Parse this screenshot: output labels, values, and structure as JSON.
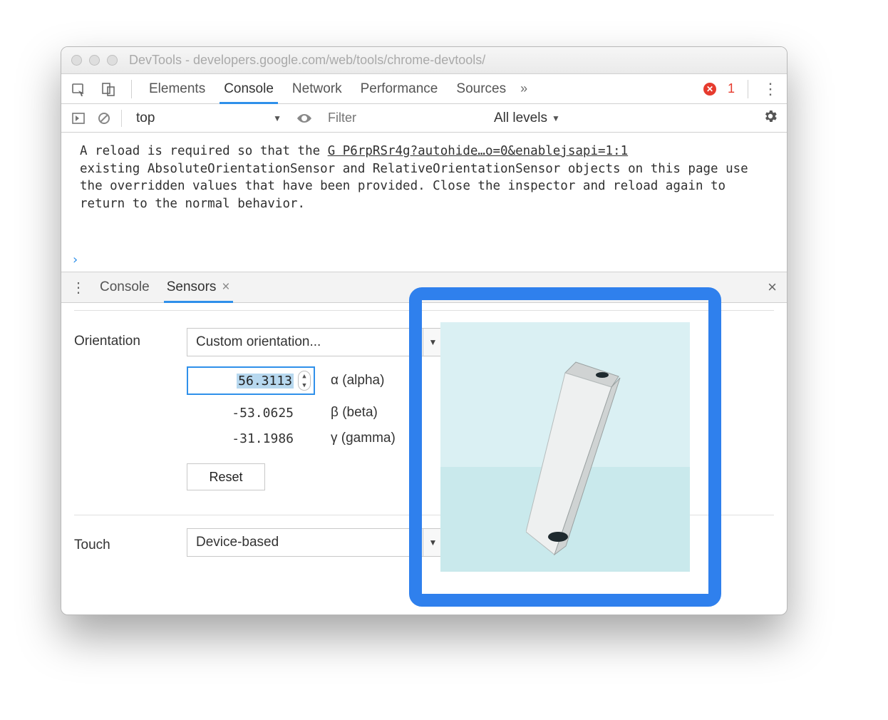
{
  "window": {
    "title": "DevTools - developers.google.com/web/tools/chrome-devtools/"
  },
  "topbar": {
    "tabs": [
      "Elements",
      "Console",
      "Network",
      "Performance",
      "Sources"
    ],
    "active_tab": "Console",
    "error_symbol": "✕",
    "error_count": "1"
  },
  "console_toolbar": {
    "context": "top",
    "filter_placeholder": "Filter",
    "levels_label": "All levels"
  },
  "console": {
    "message_prefix": "A reload is required so that the ",
    "source_link": "G P6rpRSr4g?autohide…o=0&enablejsapi=1:1",
    "message_rest": "existing AbsoluteOrientationSensor and RelativeOrientationSensor objects on this page use the overridden values that have been provided. Close the inspector and reload again to return to the normal behavior.",
    "prompt": "›"
  },
  "drawer": {
    "tabs": [
      "Console",
      "Sensors"
    ],
    "active_tab": "Sensors",
    "close_glyph": "×"
  },
  "sensors": {
    "orientation_label": "Orientation",
    "orientation_select": "Custom orientation...",
    "alpha": {
      "value": "56.3113",
      "label": "α (alpha)"
    },
    "beta": {
      "value": "-53.0625",
      "label": "β (beta)"
    },
    "gamma": {
      "value": "-31.1986",
      "label": "γ (gamma)"
    },
    "reset_label": "Reset",
    "touch_label": "Touch",
    "touch_select": "Device-based"
  }
}
